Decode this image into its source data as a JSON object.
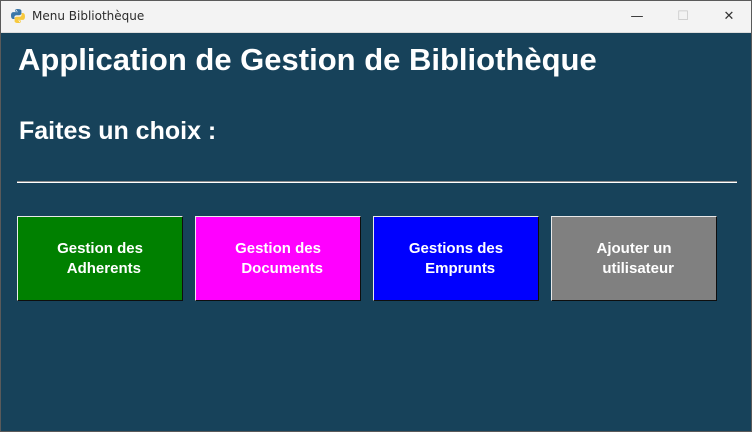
{
  "window": {
    "title": "Menu Bibliothèque",
    "controls": {
      "minimize": "—",
      "maximize": "☐",
      "close": "✕"
    }
  },
  "main": {
    "title": "Application de Gestion de Bibliothèque",
    "subtitle": "Faites un choix :"
  },
  "buttons": [
    {
      "label": "Gestion des\n  Adherents",
      "color": "#008000"
    },
    {
      "label": "Gestion des\n  Documents",
      "color": "#ff00ff"
    },
    {
      "label": "Gestions des\n  Emprunts",
      "color": "#0000ff"
    },
    {
      "label": "Ajouter un\n  utilisateur",
      "color": "#808080"
    }
  ],
  "colors": {
    "background": "#17425a",
    "text": "#ffffff"
  },
  "icons": {
    "app": "python-icon"
  }
}
